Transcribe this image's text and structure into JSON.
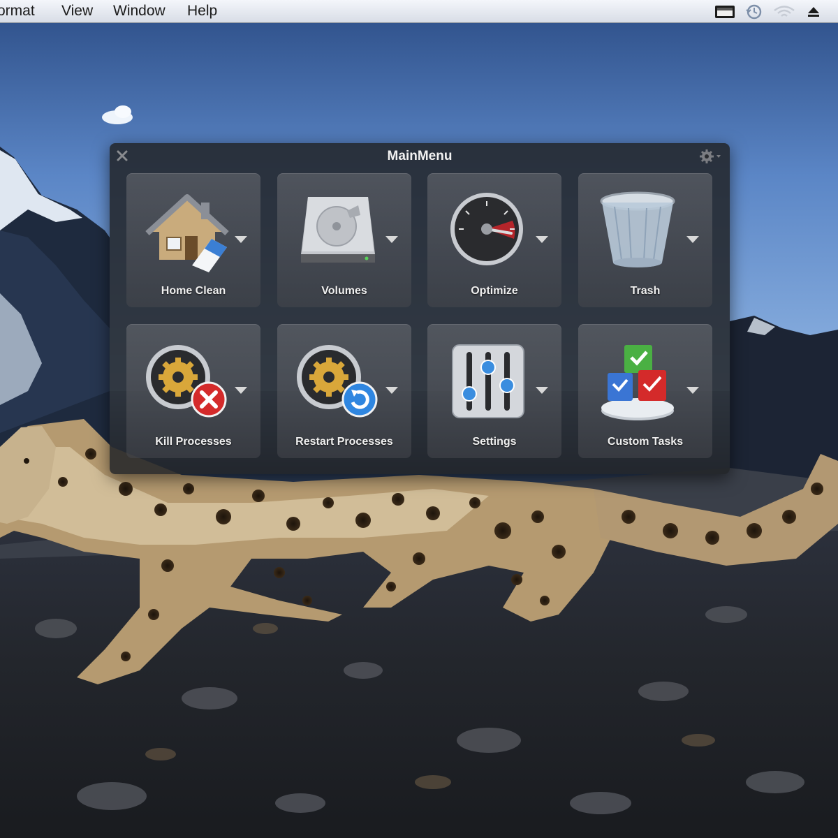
{
  "menubar": {
    "items": [
      "ormat",
      "View",
      "Window",
      "Help"
    ],
    "status_icons": [
      "display-icon",
      "time-machine-icon",
      "wifi-icon",
      "eject-icon"
    ]
  },
  "panel": {
    "title": "MainMenu",
    "close_icon": "close-icon",
    "gear_icon": "gear-icon",
    "tiles": [
      {
        "label": "Home Clean",
        "icon": "house-eraser-icon"
      },
      {
        "label": "Volumes",
        "icon": "hard-drive-icon"
      },
      {
        "label": "Optimize",
        "icon": "speedometer-icon"
      },
      {
        "label": "Trash",
        "icon": "trash-can-icon"
      },
      {
        "label": "Kill Processes",
        "icon": "gear-stop-icon"
      },
      {
        "label": "Restart Processes",
        "icon": "gear-restart-icon"
      },
      {
        "label": "Settings",
        "icon": "sliders-icon"
      },
      {
        "label": "Custom Tasks",
        "icon": "cubes-icon"
      }
    ]
  },
  "colors": {
    "panel_bg": "#222428",
    "tile_bg": "#5a5c62",
    "label_text": "#f0f0f0",
    "kill_badge": "#d42a2a",
    "restart_badge": "#2f86e0"
  }
}
